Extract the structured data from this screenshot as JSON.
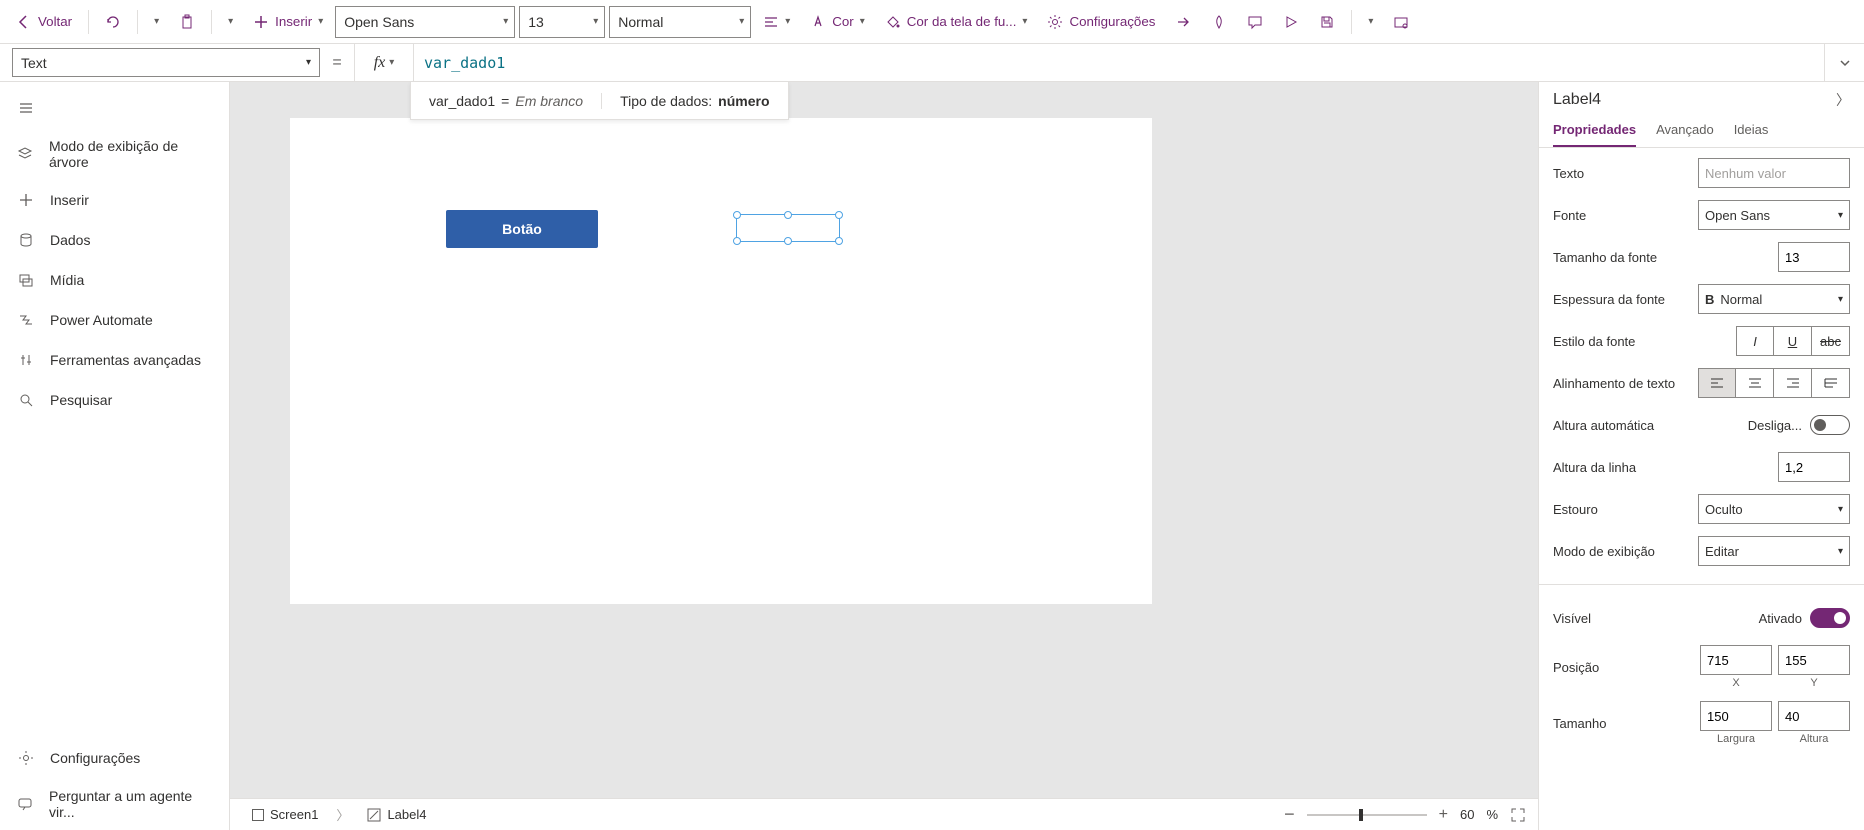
{
  "topbar": {
    "back": "Voltar",
    "insert": "Inserir",
    "font": "Open Sans",
    "font_size": "13",
    "font_weight": "Normal",
    "color_label": "Cor",
    "fill_label": "Cor da tela de fu...",
    "settings_label": "Configurações"
  },
  "formula": {
    "property": "Text",
    "expression": "var_dado1",
    "var_name": "var_dado1",
    "equals": "=",
    "blank": "Em branco",
    "type_prefix": "Tipo de dados:",
    "type_value": "número"
  },
  "leftnav": {
    "items": [
      "Modo de exibição de árvore",
      "Inserir",
      "Dados",
      "Mídia",
      "Power Automate",
      "Ferramentas avançadas",
      "Pesquisar"
    ],
    "settings": "Configurações",
    "ask_agent": "Perguntar a um agente vir..."
  },
  "canvas": {
    "button_text": "Botão"
  },
  "breadcrumb": {
    "screen": "Screen1",
    "control": "Label4",
    "zoom_pct": "60",
    "pct_sign": "%"
  },
  "right": {
    "title": "Label4",
    "tabs": {
      "props": "Propriedades",
      "advanced": "Avançado",
      "ideas": "Ideias"
    },
    "labels": {
      "text": "Texto",
      "font": "Fonte",
      "font_size": "Tamanho da fonte",
      "font_weight": "Espessura da fonte",
      "font_style": "Estilo da fonte",
      "align": "Alinhamento de texto",
      "autoheight": "Altura automática",
      "lineheight": "Altura da linha",
      "overflow": "Estouro",
      "display_mode": "Modo de exibição",
      "visible": "Visível",
      "position": "Posição",
      "size": "Tamanho"
    },
    "values": {
      "text_placeholder": "Nenhum valor",
      "font": "Open Sans",
      "font_size": "13",
      "font_weight": "Normal",
      "autoheight_state": "Desliga...",
      "lineheight": "1,2",
      "overflow": "Oculto",
      "display_mode": "Editar",
      "visible_state": "Ativado",
      "pos_x": "715",
      "pos_y": "155",
      "size_w": "150",
      "size_h": "40",
      "x_label": "X",
      "y_label": "Y",
      "w_label": "Largura",
      "h_label": "Altura",
      "bold_prefix": "B"
    }
  }
}
